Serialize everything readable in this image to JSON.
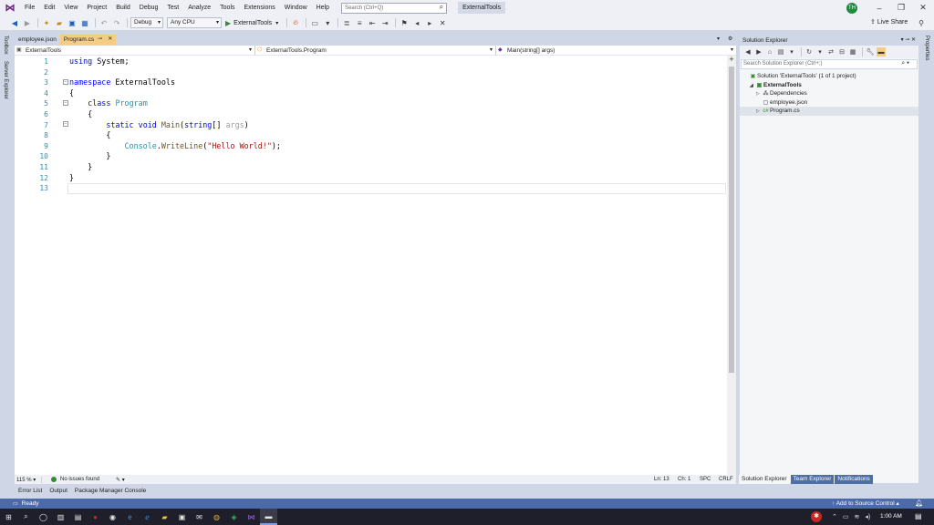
{
  "menu": {
    "items": [
      "File",
      "Edit",
      "View",
      "Project",
      "Build",
      "Debug",
      "Test",
      "Analyze",
      "Tools",
      "Extensions",
      "Window",
      "Help"
    ],
    "search_placeholder": "Search (Ctrl+Q)",
    "project_title": "ExternalTools",
    "avatar_initials": "TH"
  },
  "toolbar": {
    "config": "Debug",
    "platform": "Any CPU",
    "run_label": "ExternalTools",
    "live_share": "Live Share"
  },
  "side_tabs": {
    "left": [
      "Toolbox",
      "Server Explorer"
    ],
    "right": [
      "Properties"
    ]
  },
  "doc_tabs": [
    {
      "label": "employee.json",
      "active": false
    },
    {
      "label": "Program.cs",
      "active": true
    }
  ],
  "navbar": {
    "project": "ExternalTools",
    "class": "ExternalTools.Program",
    "member": "Main(string[] args)"
  },
  "editor": {
    "line_numbers": [
      "1",
      "2",
      "3",
      "4",
      "5",
      "6",
      "7",
      "8",
      "9",
      "10",
      "11",
      "12",
      "13"
    ],
    "lines": [
      {
        "ln": "1",
        "tokens": [
          {
            "t": "using",
            "c": "kw"
          },
          {
            "t": " System;",
            "c": ""
          }
        ]
      },
      {
        "ln": "2",
        "tokens": []
      },
      {
        "ln": "3",
        "tokens": [
          {
            "t": "namespace",
            "c": "kw"
          },
          {
            "t": " ExternalTools",
            "c": ""
          }
        ]
      },
      {
        "ln": "4",
        "tokens": [
          {
            "t": "{",
            "c": ""
          }
        ]
      },
      {
        "ln": "5",
        "tokens": [
          {
            "t": "    ",
            "c": ""
          },
          {
            "t": "class",
            "c": "kw"
          },
          {
            "t": " ",
            "c": ""
          },
          {
            "t": "Program",
            "c": "ty"
          }
        ]
      },
      {
        "ln": "6",
        "tokens": [
          {
            "t": "    {",
            "c": ""
          }
        ]
      },
      {
        "ln": "7",
        "tokens": [
          {
            "t": "        ",
            "c": ""
          },
          {
            "t": "static",
            "c": "kw"
          },
          {
            "t": " ",
            "c": ""
          },
          {
            "t": "void",
            "c": "kw"
          },
          {
            "t": " ",
            "c": ""
          },
          {
            "t": "Main",
            "c": "fn"
          },
          {
            "t": "(",
            "c": ""
          },
          {
            "t": "string",
            "c": "kw"
          },
          {
            "t": "[] ",
            "c": ""
          },
          {
            "t": "args",
            "c": "pr"
          },
          {
            "t": ")",
            "c": ""
          }
        ]
      },
      {
        "ln": "8",
        "tokens": [
          {
            "t": "        {",
            "c": ""
          }
        ]
      },
      {
        "ln": "9",
        "tokens": [
          {
            "t": "            ",
            "c": ""
          },
          {
            "t": "Console",
            "c": "ty"
          },
          {
            "t": ".",
            "c": ""
          },
          {
            "t": "WriteLine",
            "c": "fn"
          },
          {
            "t": "(",
            "c": ""
          },
          {
            "t": "\"Hello World!\"",
            "c": "st"
          },
          {
            "t": ");",
            "c": ""
          }
        ]
      },
      {
        "ln": "10",
        "tokens": [
          {
            "t": "        }",
            "c": ""
          }
        ]
      },
      {
        "ln": "11",
        "tokens": [
          {
            "t": "    }",
            "c": ""
          }
        ]
      },
      {
        "ln": "12",
        "tokens": [
          {
            "t": "}",
            "c": ""
          }
        ]
      },
      {
        "ln": "13",
        "tokens": []
      }
    ]
  },
  "editor_status": {
    "zoom": "115 %",
    "issues": "No issues found",
    "line": "Ln: 13",
    "col": "Ch: 1",
    "whitespace": "SPC",
    "eol": "CRLF"
  },
  "bottom_tabs": [
    "Error List",
    "Output",
    "Package Manager Console"
  ],
  "solution_explorer": {
    "title": "Solution Explorer",
    "search_placeholder": "Search Solution Explorer (Ctrl+;)",
    "tree": [
      {
        "label": "Solution 'ExternalTools' (1 of 1 project)",
        "icon": "solution-icon",
        "glyph": "▣",
        "twisty": "",
        "depth": 0,
        "bold": false
      },
      {
        "label": "ExternalTools",
        "icon": "csharp-project-icon",
        "glyph": "▣",
        "twisty": "◢",
        "depth": 1,
        "bold": true
      },
      {
        "label": "Dependencies",
        "icon": "dependencies-icon",
        "glyph": "⁂",
        "twisty": "▷",
        "depth": 2,
        "bold": false
      },
      {
        "label": "employee.json",
        "icon": "json-file-icon",
        "glyph": "▢",
        "twisty": "",
        "depth": 2,
        "bold": false
      },
      {
        "label": "Program.cs",
        "icon": "csharp-file-icon",
        "glyph": "c#",
        "twisty": "▷",
        "depth": 2,
        "bold": false
      }
    ],
    "tabs": [
      "Solution Explorer",
      "Team Explorer",
      "Notifications"
    ]
  },
  "status_bar": {
    "ready": "Ready",
    "source_control": "Add to Source Control"
  },
  "taskbar": {
    "clock": "1:00 AM"
  },
  "colors": {
    "accent_tab": "#f5cc84",
    "status_bar": "#4d6aa8",
    "keyword": "#0000ff",
    "type": "#2b91af",
    "string": "#a31515"
  }
}
